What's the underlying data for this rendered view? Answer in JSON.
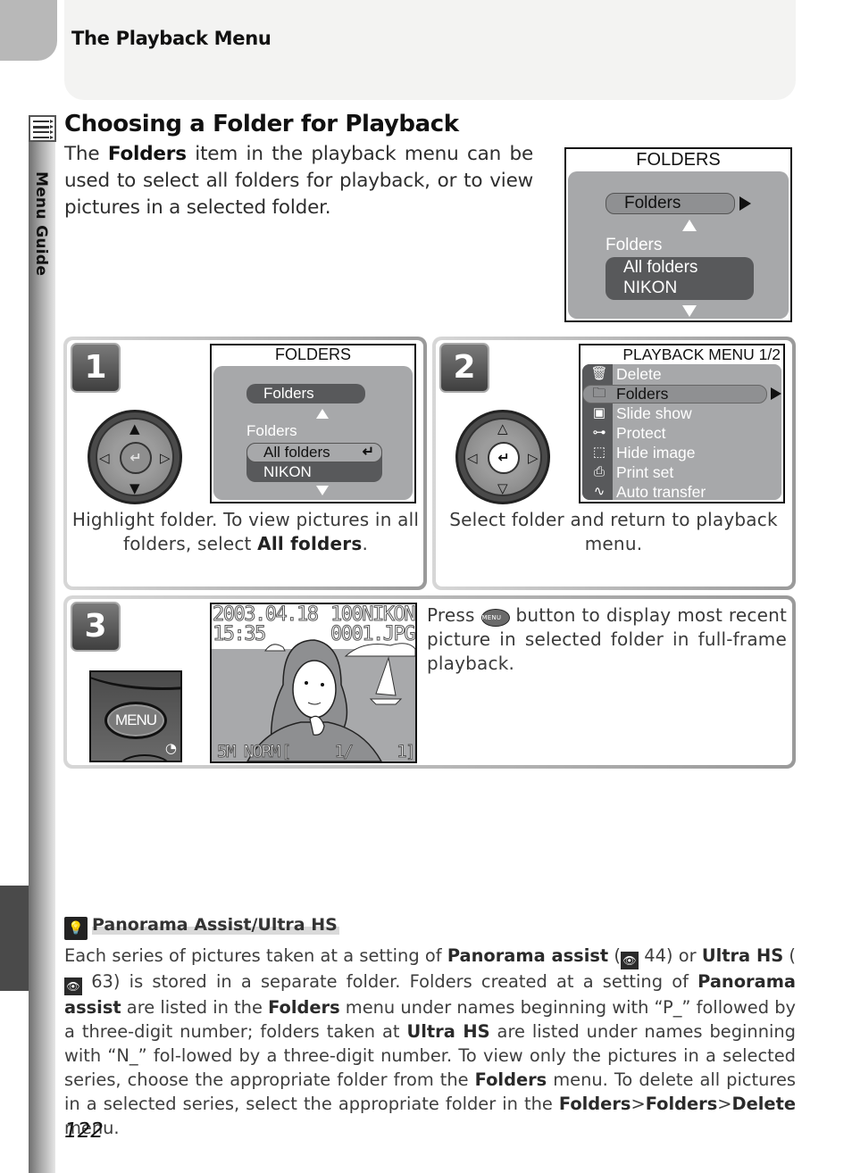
{
  "header": {
    "title": "The Playback Menu"
  },
  "sidebar": {
    "label": "Menu Guide",
    "icon": "menu-guide-icon"
  },
  "section": {
    "title": "Choosing a Folder for Playback",
    "intro": {
      "pre": "The ",
      "bold": "Folders",
      "post": " item in the playback menu can be used to select all folders for playback, or to view pictures in a selected folder."
    }
  },
  "folders_screen": {
    "title": "FOLDERS",
    "selector_label": "Folders",
    "list_heading": "Folders",
    "options": [
      "All folders",
      "NIKON"
    ]
  },
  "steps": [
    {
      "number": "1",
      "screen": {
        "title": "FOLDERS",
        "selector_label": "Folders",
        "list_heading": "Folders",
        "options": [
          "All folders",
          "NIKON"
        ],
        "highlighted": "All folders",
        "enter_glyph": "↵"
      },
      "caption": {
        "pre": "Highlight folder.  To view pictures in all folders, select ",
        "bold": "All folders",
        "post": "."
      }
    },
    {
      "number": "2",
      "screen": {
        "title": "PLAYBACK MENU 1/2",
        "items": [
          {
            "icon": "trash-icon",
            "glyph": "🗑",
            "label": "Delete"
          },
          {
            "icon": "folder-icon",
            "glyph": "🗀",
            "label": "Folders",
            "selected": true
          },
          {
            "icon": "slideshow-icon",
            "glyph": "▣",
            "label": "Slide show"
          },
          {
            "icon": "key-icon",
            "glyph": "⊶",
            "label": "Protect"
          },
          {
            "icon": "hide-image-icon",
            "glyph": "⬚",
            "label": "Hide image"
          },
          {
            "icon": "print-icon",
            "glyph": "⎙",
            "label": "Print set"
          },
          {
            "icon": "transfer-icon",
            "glyph": "∿",
            "label": "Auto transfer"
          }
        ]
      },
      "caption": {
        "text": "Select folder and return to playback menu."
      }
    },
    {
      "number": "3",
      "button_label": "MENU",
      "photo": {
        "date": "2003.04.18",
        "time": "15:35",
        "folder": "100NIKON",
        "file": "0001.JPG",
        "quality": "5M NORM",
        "counter": "[     1/     1]"
      },
      "caption": {
        "pre": "Press ",
        "icon_label": "MENU",
        "post": " button to display most recent picture in selected folder in full-frame playback."
      }
    }
  ],
  "tip": {
    "title": "Panorama Assist/Ultra HS",
    "body_parts": [
      {
        "t": "Each series of pictures taken at a setting of "
      },
      {
        "b": "Panorama assist"
      },
      {
        "t": " ("
      },
      {
        "ref": "👁"
      },
      {
        "t": " 44) or "
      },
      {
        "b": "Ultra HS"
      },
      {
        "t": " ("
      },
      {
        "ref": "👁"
      },
      {
        "t": " 63) is stored in a separate folder.  Folders created at a setting of "
      },
      {
        "b": "Panorama assist"
      },
      {
        "t": " are listed in the "
      },
      {
        "b": "Folders"
      },
      {
        "t": " menu under names beginning with “P_” followed by a three-digit number; folders taken at "
      },
      {
        "b": "Ultra HS"
      },
      {
        "t": " are listed under names beginning with “N_” fol-lowed by a three-digit number.  To view only the pictures in a selected series, choose the appropriate folder from the "
      },
      {
        "b": "Folders"
      },
      {
        "t": " menu.  To delete all pictures in a selected series, select the appropriate folder in the "
      },
      {
        "b": "Folders"
      },
      {
        "t": ">"
      },
      {
        "b": "Folders"
      },
      {
        "t": ">"
      },
      {
        "b": "Delete"
      },
      {
        "t": " menu."
      }
    ]
  },
  "page_number": "122"
}
